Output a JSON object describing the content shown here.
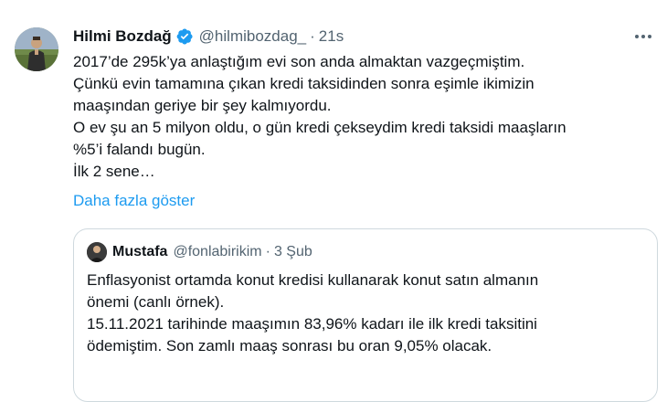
{
  "tweet": {
    "author_name": "Hilmi Bozdağ",
    "author_handle": "@hilmibozdag_",
    "separator": "·",
    "time": "21s",
    "more_icon": "more-horizontal-icon",
    "verified_icon": "verified-badge-icon",
    "body_lines": [
      "2017’de 295k’ya anlaştığım evi son anda almaktan vazgeçmiştim.",
      "Çünkü evin tamamına çıkan kredi taksidinden sonra eşimle ikimizin",
      "maaşından geriye bir şey kalmıyordu.",
      "O ev şu an 5 milyon oldu, o gün kredi çekseydim kredi taksidi maaşların",
      "%5’i falandı bugün.",
      "İlk 2 sene…"
    ],
    "show_more_label": "Daha fazla göster"
  },
  "quote": {
    "author_name": "Mustafa",
    "author_handle": "@fonlabirikim",
    "separator": "·",
    "time": "3 Şub",
    "body_lines": [
      "Enflasyonist ortamda konut kredisi kullanarak konut satın almanın",
      "önemi (canlı örnek).",
      "15.11.2021 tarihinde maaşımın 83,96% kadarı ile ilk kredi taksitini",
      "ödemiştim. Son zamlı maaş sonrası bu oran 9,05% olacak."
    ]
  },
  "colors": {
    "accent": "#1d9bf0",
    "text_primary": "#0f1419",
    "text_secondary": "#536471",
    "border": "#cfd9de"
  }
}
